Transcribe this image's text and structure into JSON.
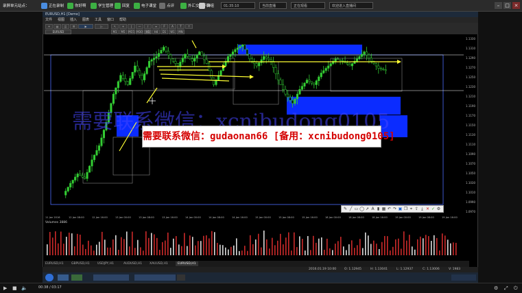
{
  "topbar": {
    "app_label": "录屏单元站点：",
    "items": [
      {
        "label": "正在录制",
        "color": "#4a8de0"
      },
      {
        "label": "你好啊",
        "color": "#3cb043"
      },
      {
        "label": "学生管理",
        "color": "#3cb043"
      },
      {
        "label": "回复",
        "color": "#3cb043"
      },
      {
        "label": "电子课堂",
        "color": "#3cb043"
      },
      {
        "label": "点评",
        "color": "#6e6e6e"
      },
      {
        "label": "外汇交易平台",
        "color": "#3cb043"
      },
      {
        "label": "群组",
        "color": "#cccccc"
      }
    ],
    "input1": "01:35:10",
    "input2": "当前直播",
    "input3": "正在观看",
    "input4": "欢迎进入直播间"
  },
  "mt4": {
    "title": "EURUSD,H1 [Demo]",
    "menu": [
      "文件",
      "视图",
      "插入",
      "图表",
      "工具",
      "窗口",
      "帮助"
    ],
    "timeframes": [
      "M1",
      "M5",
      "M15",
      "M30",
      "H1",
      "H4",
      "D1",
      "W1",
      "MN"
    ],
    "symbol_info": "EURUSD,H1  1.12945 1.13041 1.12937 1.13006",
    "volume_label": "Volumes 3886",
    "date_labels": [
      "11 Jan 2016",
      "12 Jan 08:00",
      "12 Jan 16:00",
      "13 Jan 00:00",
      "13 Jan 08:00",
      "13 Jan 16:00",
      "14 Jan 00:00",
      "14 Jan 08:00",
      "14 Jan 16:00",
      "15 Jan 00:00",
      "15 Jan 08:00",
      "15 Jan 16:00",
      "18 Jan 00:00",
      "18 Jan 08:00",
      "18 Jan 16:00",
      "19 Jan 00:00",
      "19 Jan 08:00",
      "19 Jan 16:00"
    ],
    "price_labels": [
      "1.1330",
      "1.1310",
      "1.1290",
      "1.1270",
      "1.1250",
      "1.1230",
      "1.1210",
      "1.1190",
      "1.1170",
      "1.1150",
      "1.1130",
      "1.1110",
      "1.1090",
      "1.1070",
      "1.1050",
      "1.1030",
      "1.1010",
      "1.0990",
      "1.0970"
    ],
    "tabs": [
      "EURUSD,H1",
      "GBPUSD,H1",
      "USDJPY,H1",
      "AUDUSD,H1",
      "XAUUSD,H1",
      "EURUSD,H1"
    ],
    "status": [
      "2016.01.19 10:00",
      "O: 1.12945",
      "H: 1.13041",
      "L: 1.12937",
      "C: 1.13006",
      "V: 1983"
    ]
  },
  "watermark": {
    "background_text": "需要联系微信：xcnibudong0105",
    "banner_text": "需要联系微信：gudaonan66 [备用：xcnibudong0105]"
  },
  "bottombar": {
    "time_label": "00:38 / 03:17"
  },
  "colors": {
    "candle_up": "#33cc33",
    "zone_blue": "#0b2cff",
    "arrow_yellow": "#ffff33",
    "volume_red": "#cc2a2a",
    "banner_red": "#d40000"
  },
  "chart_data": {
    "type": "line",
    "x": [
      0,
      6,
      12,
      18,
      24,
      30,
      36,
      42,
      48,
      54,
      60,
      66,
      72,
      78,
      84,
      90,
      96,
      102,
      108,
      114,
      120,
      126,
      132,
      138,
      144,
      150,
      156,
      162,
      168,
      174,
      180,
      186,
      192,
      198,
      204,
      210,
      216,
      222,
      228,
      234,
      240,
      246,
      252,
      258,
      264,
      270
    ],
    "series": [
      {
        "values": [
          1.1015,
          1.104,
          1.106,
          1.105,
          1.109,
          1.112,
          1.117,
          1.123,
          1.127,
          1.125,
          1.129,
          1.126,
          1.13,
          1.131,
          1.133,
          1.1305,
          1.129,
          1.1315,
          1.13,
          1.132,
          1.1295,
          1.125,
          1.128,
          1.131,
          1.1325,
          1.1335,
          1.1305,
          1.129,
          1.131,
          1.13,
          1.126,
          1.123,
          1.121,
          1.124,
          1.126,
          1.125,
          1.1275,
          1.129,
          1.1305,
          1.13,
          1.129,
          1.1305,
          1.132,
          1.13,
          1.1285,
          1.128
        ]
      }
    ],
    "ylim": [
      1.097,
      1.135
    ]
  }
}
